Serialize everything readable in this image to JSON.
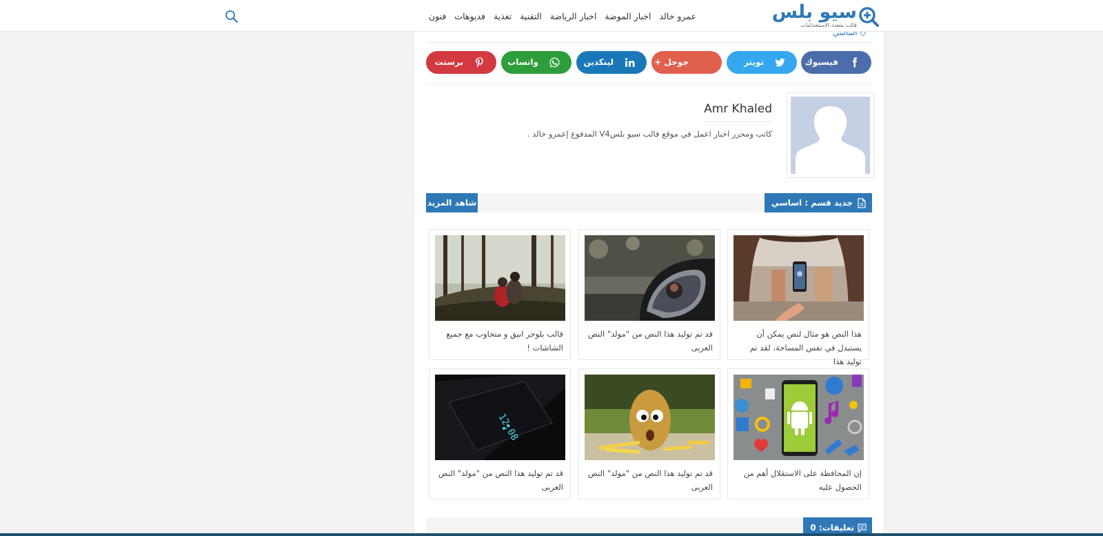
{
  "header": {
    "logo_text": "سيو بلس",
    "logo_tagline": "قالب متعدد الاستخدامات",
    "nav": [
      "فنون",
      "فديوهات",
      "تغذية",
      "التقنية",
      "اخبار الرياضة",
      "اخبار الموضة",
      "عمرو خالد"
    ]
  },
  "breadcrumb_label": "اساسي",
  "share": {
    "facebook": "فيسبوك",
    "twitter": "تويتر",
    "googleplus": "جوجل +",
    "linkedin": "لينكدين",
    "whatsapp": "واتساب",
    "pinterest": "برستت"
  },
  "author": {
    "name": "Amr Khaled",
    "bio": "كاتب ومحرر اخبار اعمل في موقع قالب سيو بلسV4 المدفوع إعمرو خالد ."
  },
  "section": {
    "title": "جديد قسم : اساسي",
    "more": "شاهد المزيد"
  },
  "posts": [
    {
      "title": "هذا النص هو مثال لنص يمكن أن يستبدل في نفس المساحة، لقد تم توليد هذا"
    },
    {
      "title": "قد تم توليد هذا النص من \"مولد\" النص العربى"
    },
    {
      "title": "قالب بلوجر انيق و متجاوب مع جميع الشاشات !"
    },
    {
      "title": "إن المحافظة على الاستقلال أهم من الحصول عليه"
    },
    {
      "title": "قد تم توليد هذا النص من \"مولد\" النص العربى"
    },
    {
      "title": "قد تم توليد هذا النص من \"مولد\" النص العربى"
    }
  ],
  "comments": {
    "label": "تعليقات: 0"
  },
  "colors": {
    "brand": "#2f78b8",
    "facebook": "#4b6eab",
    "twitter": "#34a7ef",
    "googleplus": "#e15f4d",
    "linkedin": "#1a78b9",
    "whatsapp": "#2e9e3a",
    "pinterest": "#d33940"
  }
}
